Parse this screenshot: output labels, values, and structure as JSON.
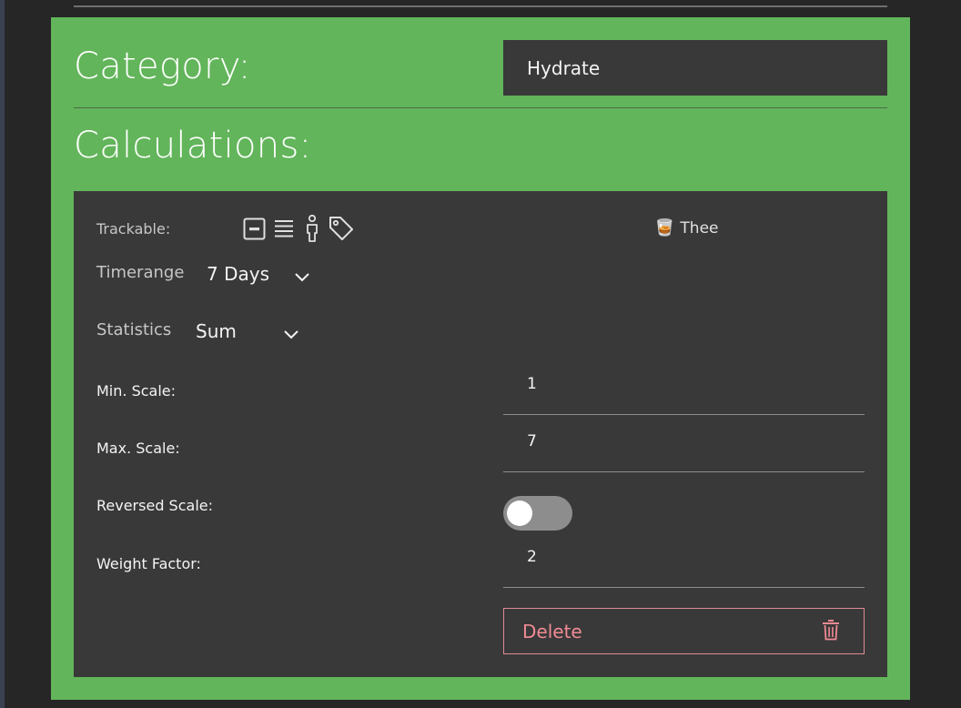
{
  "category": {
    "heading": "Category:",
    "value": "Hydrate"
  },
  "calculations": {
    "heading": "Calculations:",
    "trackable": {
      "label": "Trackable:",
      "icons": [
        "number-box-icon",
        "list-icon",
        "person-icon",
        "tag-icon"
      ],
      "selected_emoji": "🥃",
      "selected_name": "Thee"
    },
    "timerange": {
      "label": "Timerange",
      "value": "7 Days"
    },
    "statistics": {
      "label": "Statistics",
      "value": "Sum"
    },
    "min_scale": {
      "label": "Min. Scale:",
      "value": "1"
    },
    "max_scale": {
      "label": "Max. Scale:",
      "value": "7"
    },
    "reversed_scale": {
      "label": "Reversed Scale:",
      "on": false
    },
    "weight_factor": {
      "label": "Weight Factor:",
      "value": "2"
    },
    "delete_label": "Delete"
  },
  "colors": {
    "panel_green": "#62b55a",
    "card_bg": "#393939",
    "page_bg": "#262626",
    "danger": "#f08a94"
  }
}
